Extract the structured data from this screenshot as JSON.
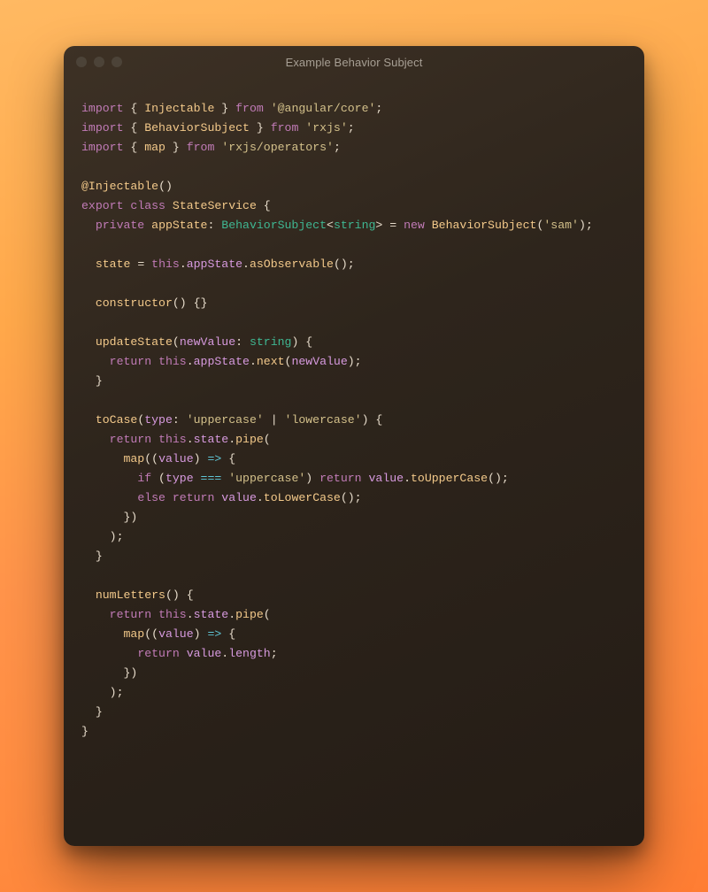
{
  "window": {
    "title": "Example Behavior Subject"
  },
  "code": {
    "lines": [
      [
        [
          "kw",
          "import"
        ],
        [
          "pn",
          " { "
        ],
        [
          "fn",
          "Injectable"
        ],
        [
          "pn",
          " } "
        ],
        [
          "kw",
          "from"
        ],
        [
          "pn",
          " "
        ],
        [
          "str",
          "'@angular/core'"
        ],
        [
          "pn",
          ";"
        ]
      ],
      [
        [
          "kw",
          "import"
        ],
        [
          "pn",
          " { "
        ],
        [
          "fn",
          "BehaviorSubject"
        ],
        [
          "pn",
          " } "
        ],
        [
          "kw",
          "from"
        ],
        [
          "pn",
          " "
        ],
        [
          "str",
          "'rxjs'"
        ],
        [
          "pn",
          ";"
        ]
      ],
      [
        [
          "kw",
          "import"
        ],
        [
          "pn",
          " { "
        ],
        [
          "fn",
          "map"
        ],
        [
          "pn",
          " } "
        ],
        [
          "kw",
          "from"
        ],
        [
          "pn",
          " "
        ],
        [
          "str",
          "'rxjs/operators'"
        ],
        [
          "pn",
          ";"
        ]
      ],
      [],
      [
        [
          "fn",
          "@Injectable"
        ],
        [
          "pn",
          "()"
        ]
      ],
      [
        [
          "kw",
          "export"
        ],
        [
          "pn",
          " "
        ],
        [
          "kw",
          "class"
        ],
        [
          "pn",
          " "
        ],
        [
          "fn",
          "StateService"
        ],
        [
          "pn",
          " {"
        ]
      ],
      [
        [
          "pn",
          "  "
        ],
        [
          "kw",
          "private"
        ],
        [
          "pn",
          " "
        ],
        [
          "fn",
          "appState"
        ],
        [
          "pn",
          ": "
        ],
        [
          "type",
          "BehaviorSubject"
        ],
        [
          "pn",
          "<"
        ],
        [
          "type",
          "string"
        ],
        [
          "pn",
          "> = "
        ],
        [
          "kw",
          "new"
        ],
        [
          "pn",
          " "
        ],
        [
          "fn",
          "BehaviorSubject"
        ],
        [
          "pn",
          "("
        ],
        [
          "str",
          "'sam'"
        ],
        [
          "pn",
          ");"
        ]
      ],
      [],
      [
        [
          "pn",
          "  "
        ],
        [
          "fn",
          "state"
        ],
        [
          "pn",
          " = "
        ],
        [
          "kw",
          "this"
        ],
        [
          "pn",
          "."
        ],
        [
          "prop",
          "appState"
        ],
        [
          "pn",
          "."
        ],
        [
          "fn",
          "asObservable"
        ],
        [
          "pn",
          "();"
        ]
      ],
      [],
      [
        [
          "pn",
          "  "
        ],
        [
          "fn",
          "constructor"
        ],
        [
          "pn",
          "() {}"
        ]
      ],
      [],
      [
        [
          "pn",
          "  "
        ],
        [
          "fn",
          "updateState"
        ],
        [
          "pn",
          "("
        ],
        [
          "prop",
          "newValue"
        ],
        [
          "pn",
          ": "
        ],
        [
          "type",
          "string"
        ],
        [
          "pn",
          ") {"
        ]
      ],
      [
        [
          "pn",
          "    "
        ],
        [
          "kw",
          "return"
        ],
        [
          "pn",
          " "
        ],
        [
          "kw",
          "this"
        ],
        [
          "pn",
          "."
        ],
        [
          "prop",
          "appState"
        ],
        [
          "pn",
          "."
        ],
        [
          "fn",
          "next"
        ],
        [
          "pn",
          "("
        ],
        [
          "prop",
          "newValue"
        ],
        [
          "pn",
          ");"
        ]
      ],
      [
        [
          "pn",
          "  }"
        ]
      ],
      [],
      [
        [
          "pn",
          "  "
        ],
        [
          "fn",
          "toCase"
        ],
        [
          "pn",
          "("
        ],
        [
          "prop",
          "type"
        ],
        [
          "pn",
          ": "
        ],
        [
          "str",
          "'uppercase'"
        ],
        [
          "pn",
          " | "
        ],
        [
          "str",
          "'lowercase'"
        ],
        [
          "pn",
          ") {"
        ]
      ],
      [
        [
          "pn",
          "    "
        ],
        [
          "kw",
          "return"
        ],
        [
          "pn",
          " "
        ],
        [
          "kw",
          "this"
        ],
        [
          "pn",
          "."
        ],
        [
          "prop",
          "state"
        ],
        [
          "pn",
          "."
        ],
        [
          "fn",
          "pipe"
        ],
        [
          "pn",
          "("
        ]
      ],
      [
        [
          "pn",
          "      "
        ],
        [
          "fn",
          "map"
        ],
        [
          "pn",
          "(("
        ],
        [
          "prop",
          "value"
        ],
        [
          "pn",
          ") "
        ],
        [
          "op",
          "=>"
        ],
        [
          "pn",
          " {"
        ]
      ],
      [
        [
          "pn",
          "        "
        ],
        [
          "kw",
          "if"
        ],
        [
          "pn",
          " ("
        ],
        [
          "prop",
          "type"
        ],
        [
          "pn",
          " "
        ],
        [
          "op",
          "==="
        ],
        [
          "pn",
          " "
        ],
        [
          "str",
          "'uppercase'"
        ],
        [
          "pn",
          ") "
        ],
        [
          "kw",
          "return"
        ],
        [
          "pn",
          " "
        ],
        [
          "prop",
          "value"
        ],
        [
          "pn",
          "."
        ],
        [
          "fn",
          "toUpperCase"
        ],
        [
          "pn",
          "();"
        ]
      ],
      [
        [
          "pn",
          "        "
        ],
        [
          "kw",
          "else"
        ],
        [
          "pn",
          " "
        ],
        [
          "kw",
          "return"
        ],
        [
          "pn",
          " "
        ],
        [
          "prop",
          "value"
        ],
        [
          "pn",
          "."
        ],
        [
          "fn",
          "toLowerCase"
        ],
        [
          "pn",
          "();"
        ]
      ],
      [
        [
          "pn",
          "      })"
        ]
      ],
      [
        [
          "pn",
          "    );"
        ]
      ],
      [
        [
          "pn",
          "  }"
        ]
      ],
      [],
      [
        [
          "pn",
          "  "
        ],
        [
          "fn",
          "numLetters"
        ],
        [
          "pn",
          "() {"
        ]
      ],
      [
        [
          "pn",
          "    "
        ],
        [
          "kw",
          "return"
        ],
        [
          "pn",
          " "
        ],
        [
          "kw",
          "this"
        ],
        [
          "pn",
          "."
        ],
        [
          "prop",
          "state"
        ],
        [
          "pn",
          "."
        ],
        [
          "fn",
          "pipe"
        ],
        [
          "pn",
          "("
        ]
      ],
      [
        [
          "pn",
          "      "
        ],
        [
          "fn",
          "map"
        ],
        [
          "pn",
          "(("
        ],
        [
          "prop",
          "value"
        ],
        [
          "pn",
          ") "
        ],
        [
          "op",
          "=>"
        ],
        [
          "pn",
          " {"
        ]
      ],
      [
        [
          "pn",
          "        "
        ],
        [
          "kw",
          "return"
        ],
        [
          "pn",
          " "
        ],
        [
          "prop",
          "value"
        ],
        [
          "pn",
          "."
        ],
        [
          "prop",
          "length"
        ],
        [
          "pn",
          ";"
        ]
      ],
      [
        [
          "pn",
          "      })"
        ]
      ],
      [
        [
          "pn",
          "    );"
        ]
      ],
      [
        [
          "pn",
          "  }"
        ]
      ],
      [
        [
          "pn",
          "}"
        ]
      ]
    ]
  }
}
